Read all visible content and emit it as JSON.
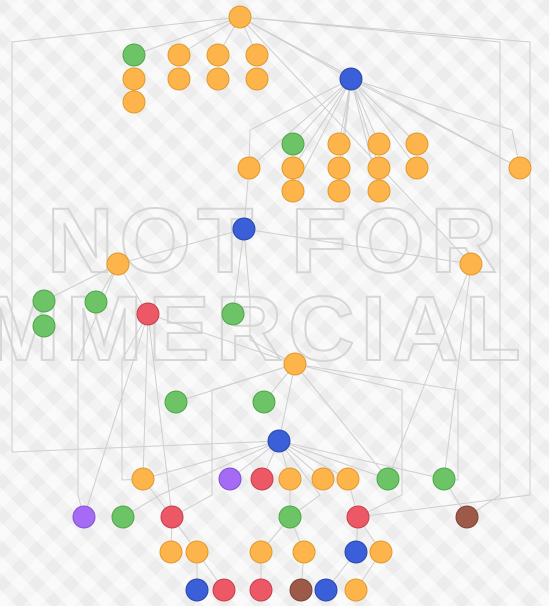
{
  "watermark": {
    "lines": [
      "NOT FOR",
      "MMERCIAL"
    ],
    "color": "#d9d9d9"
  },
  "palette": {
    "orange": {
      "fill": "#fdb44b",
      "stroke": "#e09a2e"
    },
    "green": {
      "fill": "#6cc466",
      "stroke": "#4fa64a"
    },
    "blue": {
      "fill": "#3b5fd9",
      "stroke": "#2a46a8"
    },
    "red": {
      "fill": "#ec5866",
      "stroke": "#c53f4c"
    },
    "purple": {
      "fill": "#a66bf5",
      "stroke": "#8450d0"
    },
    "brown": {
      "fill": "#9e5a48",
      "stroke": "#7c4334"
    }
  }
}
